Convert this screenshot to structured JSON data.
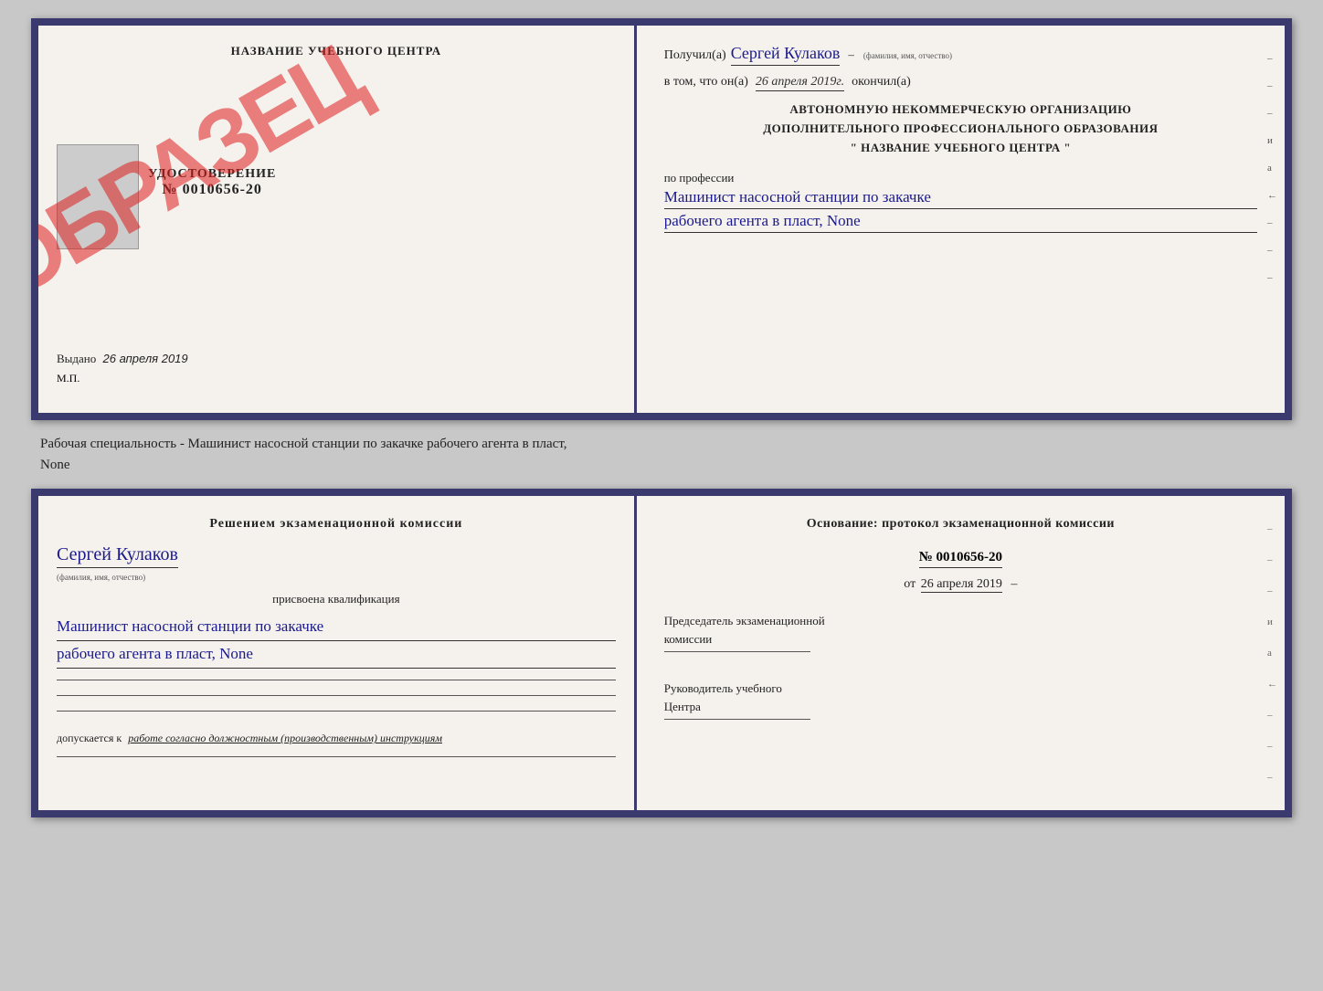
{
  "topCert": {
    "left": {
      "title": "НАЗВАНИЕ УЧЕБНОГО ЦЕНТРА",
      "obrasec": "ОБРАЗЕЦ",
      "udostoverenie_label": "УДОСТОВЕРЕНИЕ",
      "udostoverenie_num": "№ 0010656-20",
      "vydano_prefix": "Выдано",
      "vydano_date": "26 апреля 2019",
      "mp_label": "М.П."
    },
    "right": {
      "poluchil_prefix": "Получил(а)",
      "poluchil_name": "Сергей Кулаков",
      "fio_hint": "(фамилия, имя, отчество)",
      "vtom_prefix": "в том, что он(а)",
      "vtom_date": "26 апреля 2019г.",
      "okonchil": "окончил(а)",
      "org_line1": "АВТОНОМНУЮ НЕКОММЕРЧЕСКУЮ ОРГАНИЗАЦИЮ",
      "org_line2": "ДОПОЛНИТЕЛЬНОГО ПРОФЕССИОНАЛЬНОГО ОБРАЗОВАНИЯ",
      "org_line3": "\" НАЗВАНИЕ УЧЕБНОГО ЦЕНТРА \"",
      "po_professii": "по профессии",
      "profession_line1": "Машинист насосной станции по закачке",
      "profession_line2": "рабочего агента в пласт, None",
      "right_marks": [
        "-",
        "-",
        "-",
        "и",
        "а",
        "←",
        "-",
        "-",
        "-"
      ]
    }
  },
  "middleText": {
    "line1": "Рабочая специальность - Машинист насосной станции по закачке рабочего агента в пласт,",
    "line2": "None"
  },
  "bottomCert": {
    "left": {
      "decision_line1": "Решением экзаменационной комиссии",
      "name": "Сергей Кулаков",
      "fio_hint": "(фамилия, имя, отчество)",
      "prisvoena": "присвоена квалификация",
      "qual_line1": "Машинист насосной станции по закачке",
      "qual_line2": "рабочего агента в пласт, None",
      "dopusk_prefix": "допускается к",
      "dopusk_text": "работе согласно должностным (производственным) инструкциям"
    },
    "right": {
      "osnov_text": "Основание: протокол экзаменационной комиссии",
      "protocol_num": "№ 0010656-20",
      "ot_prefix": "от",
      "ot_date": "26 апреля 2019",
      "predsedatel_line1": "Председатель экзаменационной",
      "predsedatel_line2": "комиссии",
      "rukovoditel_line1": "Руководитель учебного",
      "rukovoditel_line2": "Центра",
      "right_marks": [
        "-",
        "-",
        "-",
        "и",
        "а",
        "←",
        "-",
        "-",
        "-"
      ]
    }
  }
}
